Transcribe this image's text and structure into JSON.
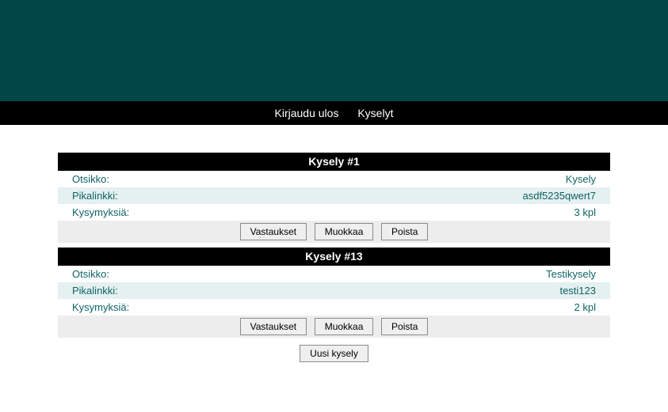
{
  "nav": {
    "logout": "Kirjaudu ulos",
    "surveys": "Kyselyt"
  },
  "buttons": {
    "responses": "Vastaukset",
    "edit": "Muokkaa",
    "delete": "Poista",
    "new_survey": "Uusi kysely"
  },
  "labels": {
    "title": "Otsikko:",
    "quicklink": "Pikalinkki:",
    "questions": "Kysymyksiä:"
  },
  "surveys": [
    {
      "header": "Kysely #1",
      "title": "Kysely",
      "quicklink": "asdf5235qwert7",
      "questions": "3 kpl"
    },
    {
      "header": "Kysely #13",
      "title": "Testikysely",
      "quicklink": "testi123",
      "questions": "2 kpl"
    }
  ]
}
